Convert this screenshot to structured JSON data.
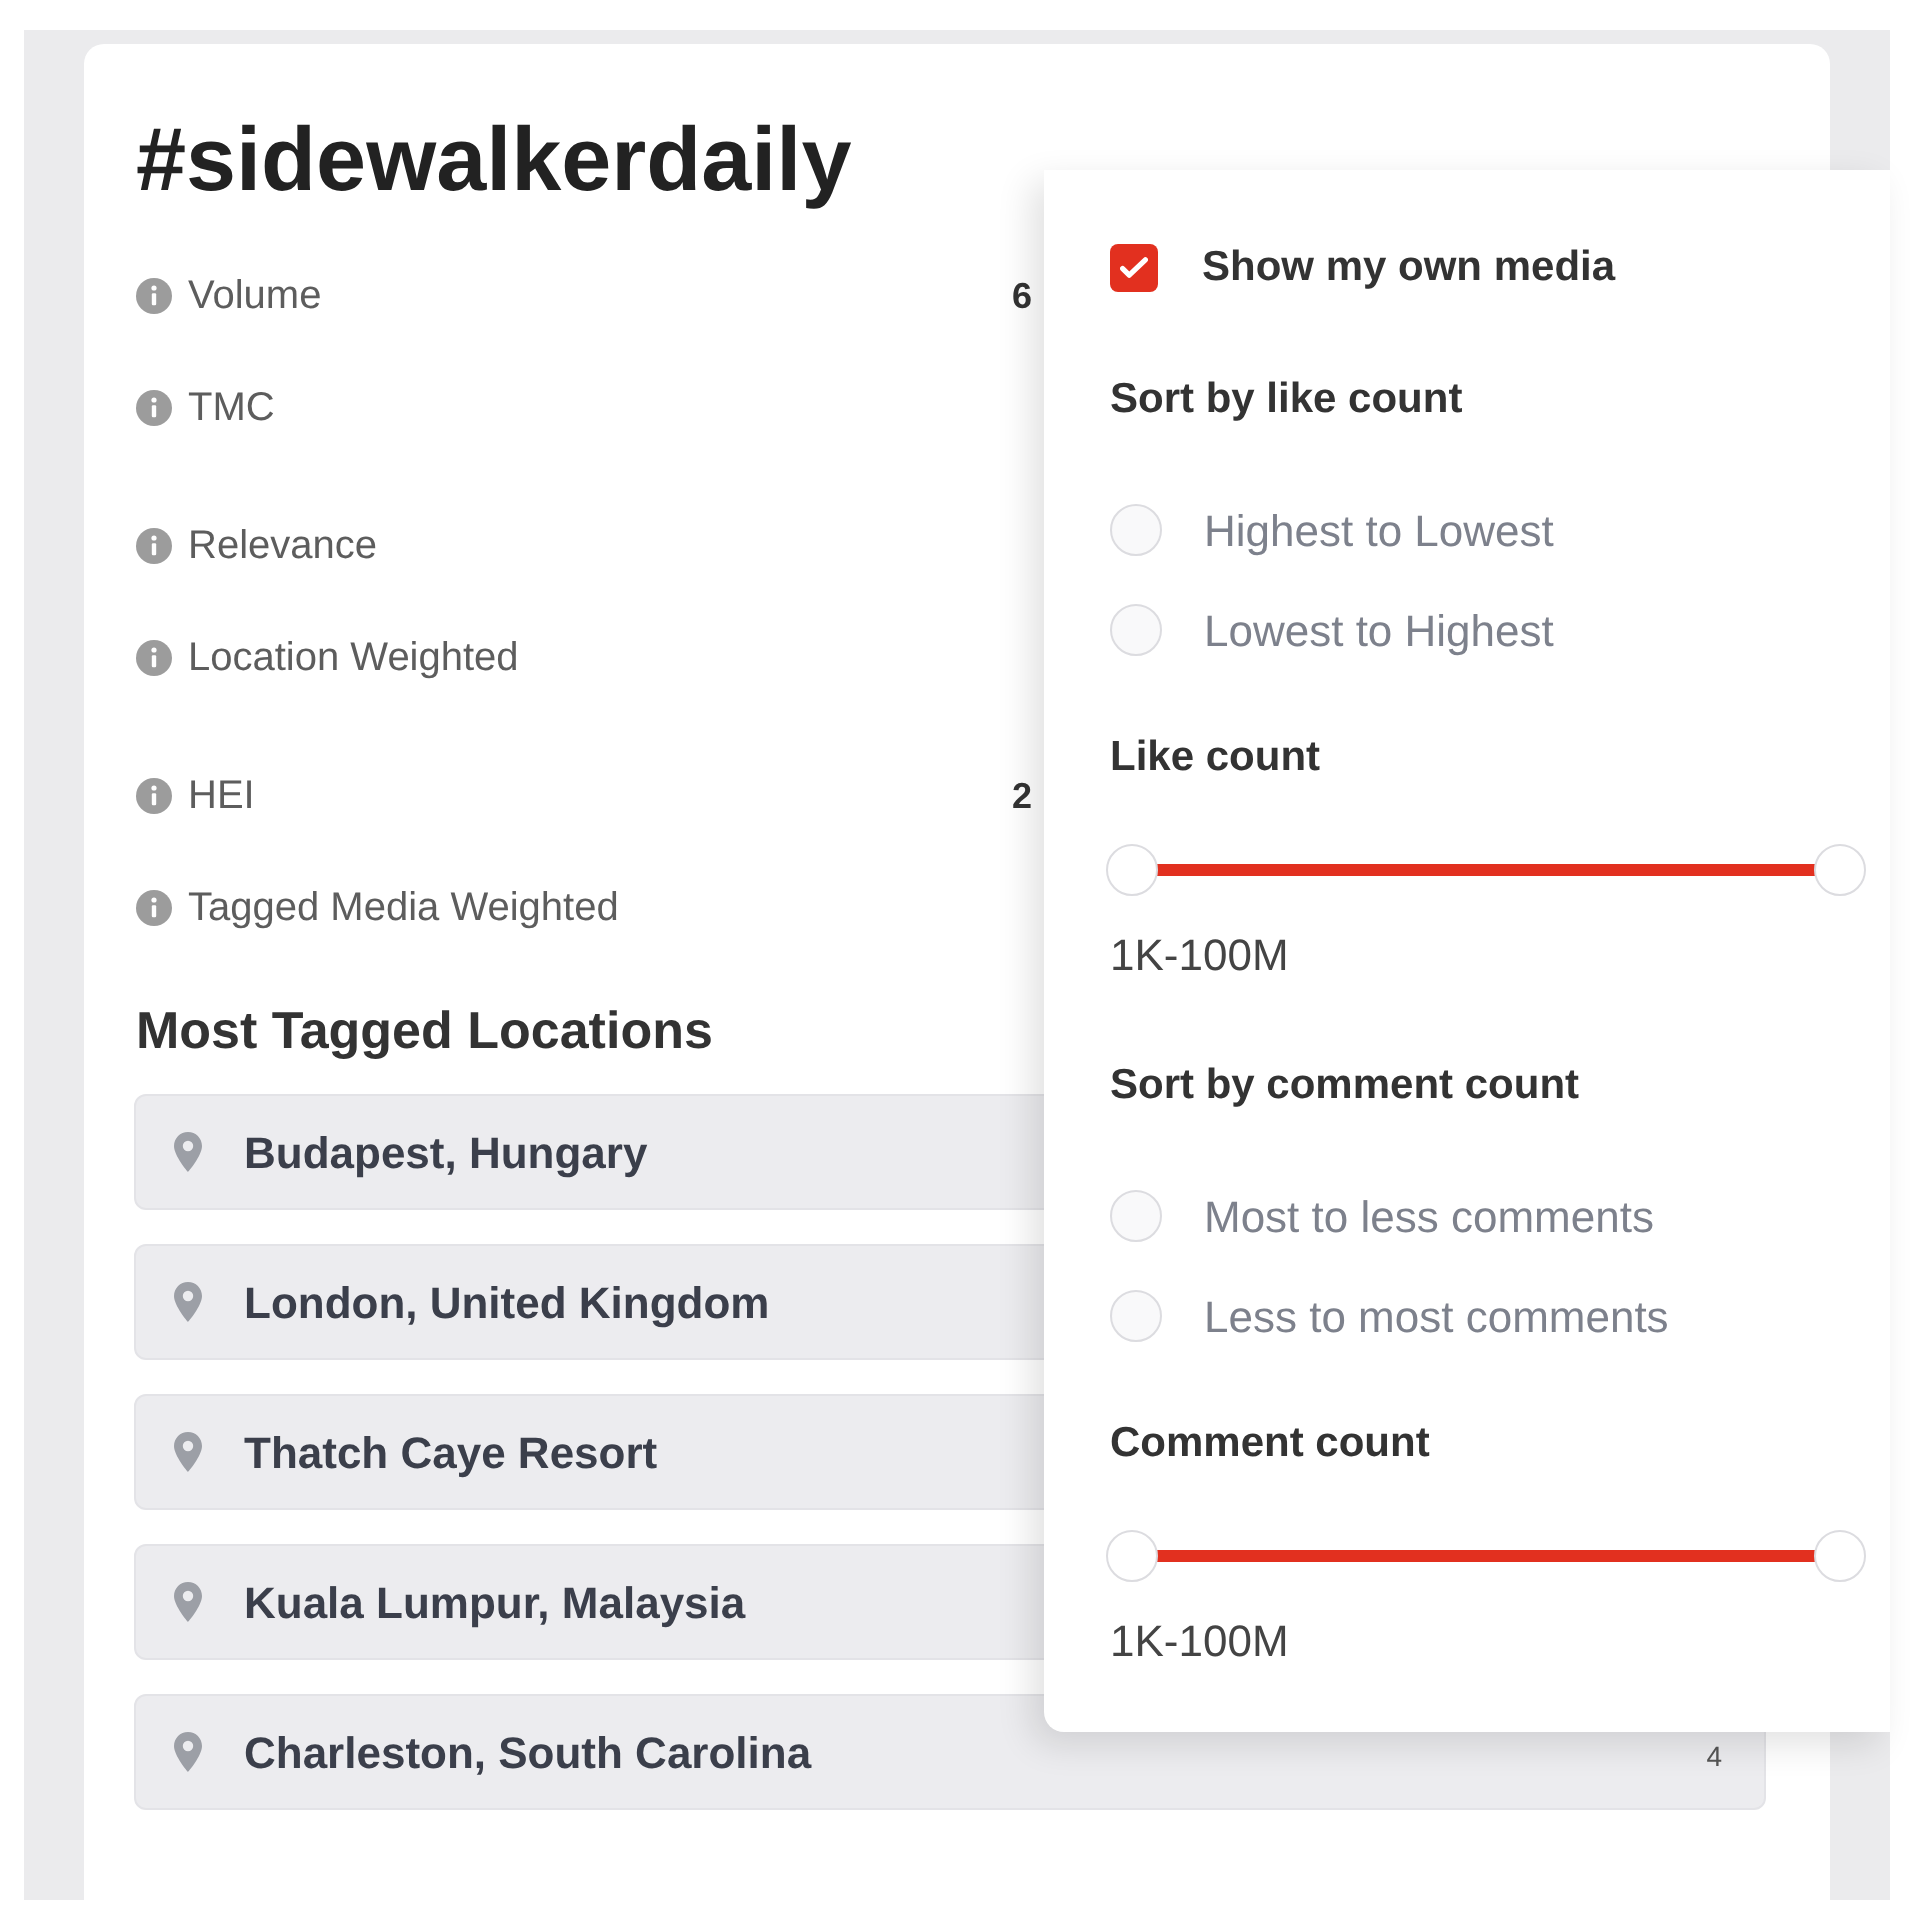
{
  "card": {
    "title": "#sidewalkerdaily",
    "metrics": [
      {
        "label": "Volume",
        "value": "6"
      },
      {
        "label": "TMC"
      },
      {
        "label": "Relevance"
      },
      {
        "label": "Location Weighted"
      },
      {
        "label": "HEI",
        "value": "2"
      },
      {
        "label": "Tagged Media Weighted"
      }
    ],
    "locations_heading": "Most Tagged Locations",
    "locations": [
      {
        "name": "Budapest, Hungary"
      },
      {
        "name": "London, United Kingdom"
      },
      {
        "name": "Thatch Caye Resort"
      },
      {
        "name": "Kuala Lumpur, Malaysia"
      },
      {
        "name": "Charleston, South Carolina",
        "count": "4"
      }
    ]
  },
  "filter_menu": {
    "show_own_media": {
      "label": "Show my own media",
      "checked": true
    },
    "sections": [
      {
        "kind": "radio_group",
        "title": "Sort by like count",
        "options": [
          {
            "label": "Highest to Lowest",
            "selected": false
          },
          {
            "label": "Lowest to Highest",
            "selected": false
          }
        ]
      },
      {
        "kind": "range",
        "title": "Like count",
        "thumbs": [
          {
            "level": 0
          },
          {
            "level": 1
          }
        ],
        "reading": "1K-100M"
      },
      {
        "kind": "radio_group",
        "title": "Sort by comment count",
        "options": [
          {
            "label": "Most to less comments",
            "selected": false
          },
          {
            "label": "Less to most comments",
            "selected": false
          }
        ]
      },
      {
        "kind": "range",
        "title": "Comment count",
        "thumbs": [
          {
            "level": 0
          },
          {
            "level": 1
          }
        ],
        "reading": "1K-100M"
      }
    ]
  }
}
